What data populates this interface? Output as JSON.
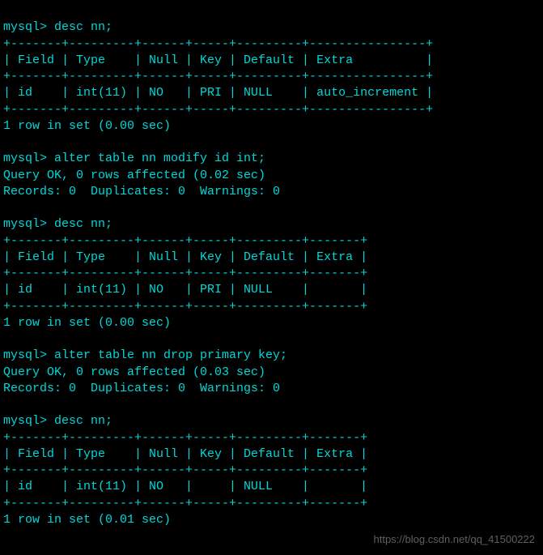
{
  "colors": {
    "bg": "#000000",
    "fg": "#00d8d8"
  },
  "prompt": "mysql> ",
  "block1": {
    "cmd": "desc nn;",
    "border_top": "+-------+---------+------+-----+---------+----------------+",
    "header": "| Field | Type    | Null | Key | Default | Extra          |",
    "row": "| id    | int(11) | NO   | PRI | NULL    | auto_increment |",
    "footer": "1 row in set (0.00 sec)"
  },
  "alter1": {
    "cmd": "alter table nn modify id int;",
    "result1": "Query OK, 0 rows affected (0.02 sec)",
    "result2": "Records: 0  Duplicates: 0  Warnings: 0"
  },
  "block2": {
    "cmd": "desc nn;",
    "border_top": "+-------+---------+------+-----+---------+-------+",
    "header": "| Field | Type    | Null | Key | Default | Extra |",
    "row": "| id    | int(11) | NO   | PRI | NULL    |       |",
    "footer": "1 row in set (0.00 sec)"
  },
  "alter2": {
    "cmd": "alter table nn drop primary key;",
    "result1": "Query OK, 0 rows affected (0.03 sec)",
    "result2": "Records: 0  Duplicates: 0  Warnings: 0"
  },
  "block3": {
    "cmd": "desc nn;",
    "border_top": "+-------+---------+------+-----+---------+-------+",
    "header": "| Field | Type    | Null | Key | Default | Extra |",
    "row": "| id    | int(11) | NO   |     | NULL    |       |",
    "footer": "1 row in set (0.01 sec)"
  },
  "watermark": "https://blog.csdn.net/qq_41500222",
  "chart_data": {
    "type": "table",
    "description": "Sequence of MySQL DESC outputs showing removal of auto_increment then primary key from column id",
    "tables": [
      {
        "command": "desc nn;",
        "columns": [
          "Field",
          "Type",
          "Null",
          "Key",
          "Default",
          "Extra"
        ],
        "rows": [
          [
            "id",
            "int(11)",
            "NO",
            "PRI",
            "NULL",
            "auto_increment"
          ]
        ],
        "footer": "1 row in set (0.00 sec)"
      },
      {
        "command": "alter table nn modify id int;",
        "result": [
          "Query OK, 0 rows affected (0.02 sec)",
          "Records: 0  Duplicates: 0  Warnings: 0"
        ]
      },
      {
        "command": "desc nn;",
        "columns": [
          "Field",
          "Type",
          "Null",
          "Key",
          "Default",
          "Extra"
        ],
        "rows": [
          [
            "id",
            "int(11)",
            "NO",
            "PRI",
            "NULL",
            ""
          ]
        ],
        "footer": "1 row in set (0.00 sec)"
      },
      {
        "command": "alter table nn drop primary key;",
        "result": [
          "Query OK, 0 rows affected (0.03 sec)",
          "Records: 0  Duplicates: 0  Warnings: 0"
        ]
      },
      {
        "command": "desc nn;",
        "columns": [
          "Field",
          "Type",
          "Null",
          "Key",
          "Default",
          "Extra"
        ],
        "rows": [
          [
            "id",
            "int(11)",
            "NO",
            "",
            "NULL",
            ""
          ]
        ],
        "footer": "1 row in set (0.01 sec)"
      }
    ]
  }
}
